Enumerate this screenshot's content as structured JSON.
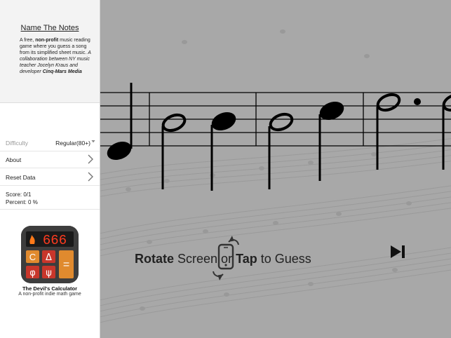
{
  "sidebar": {
    "title": "Name The Notes",
    "description": {
      "p1": "A free, ",
      "p2": "non-profit",
      "p3": " music reading game where you guess a song from its simplified sheet music. ",
      "p4": "A collaboration between NY music teacher Jocelyn Kraus and developer ",
      "p5": "Cinq-Mars Media"
    },
    "difficulty_label": "Difficulty",
    "difficulty_value": "Regular(80+)",
    "about_label": "About",
    "reset_label": "Reset Data",
    "score": "Score: 0/1",
    "percent": "Percent: 0 %"
  },
  "ad": {
    "display": "666",
    "keys": [
      "C",
      "Δ",
      "φ",
      "ψ",
      "="
    ],
    "title": "The Devil's Calculator",
    "subtitle": "A non-profit indie math game"
  },
  "main": {
    "prompt_w1": "Rotate",
    "prompt_w2": " Screen or ",
    "prompt_w3": "Tap",
    "prompt_w4": " to Guess"
  },
  "colors": {
    "stage_background": "#a9a9a9",
    "staff_ink": "#000000",
    "ad_display": "#ff3b1f",
    "ad_key_orange": "#e08a2e",
    "ad_key_red": "#c8362b"
  }
}
